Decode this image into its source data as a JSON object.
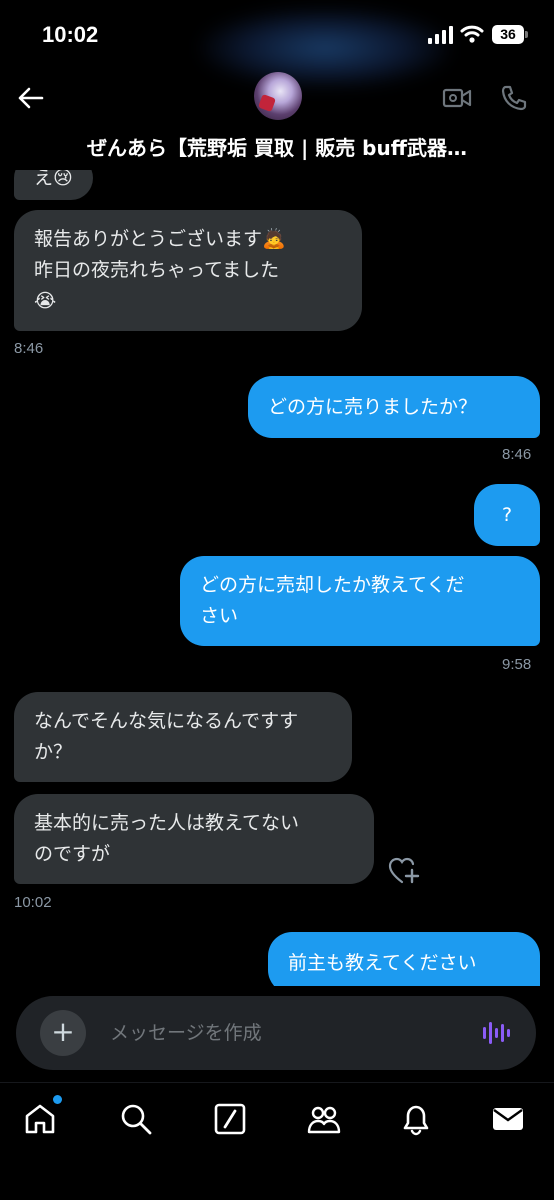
{
  "status_bar": {
    "time": "10:02",
    "battery": "36"
  },
  "header": {
    "title": "ぜんあら【荒野垢 買取 | 販売 buff武器…"
  },
  "messages": [
    {
      "text": "え😢",
      "side": "in"
    },
    {
      "text": "報告ありがとうございます🙇",
      "text2": "昨日の夜売れちゃってました",
      "text3": "😭",
      "side": "in",
      "time": "8:46"
    },
    {
      "text": "どの方に売りましたか？",
      "side": "out",
      "time": "8:46"
    },
    {
      "text": "?",
      "side": "out"
    },
    {
      "text": "どの方に売却したか教えてくだ",
      "text2": "さい",
      "side": "out",
      "time": "9:58"
    },
    {
      "text": "なんでそんな気になるんですす",
      "text2": "か？",
      "side": "in"
    },
    {
      "text": "基本的に売った人は教えてない",
      "text2": "のですが",
      "side": "in",
      "time": "10:02"
    },
    {
      "text": "前主も教えてください",
      "side": "out"
    }
  ],
  "composer": {
    "plus": "+",
    "placeholder": "メッセージを作成"
  },
  "nav": [
    "home-icon",
    "search-icon",
    "grok-icon",
    "communities-icon",
    "notifications-icon",
    "messages-icon"
  ],
  "colors": {
    "accent": "#1d9bf0",
    "incoming_bubble": "#2f3336",
    "voice_icon": "#8b5cf6"
  }
}
